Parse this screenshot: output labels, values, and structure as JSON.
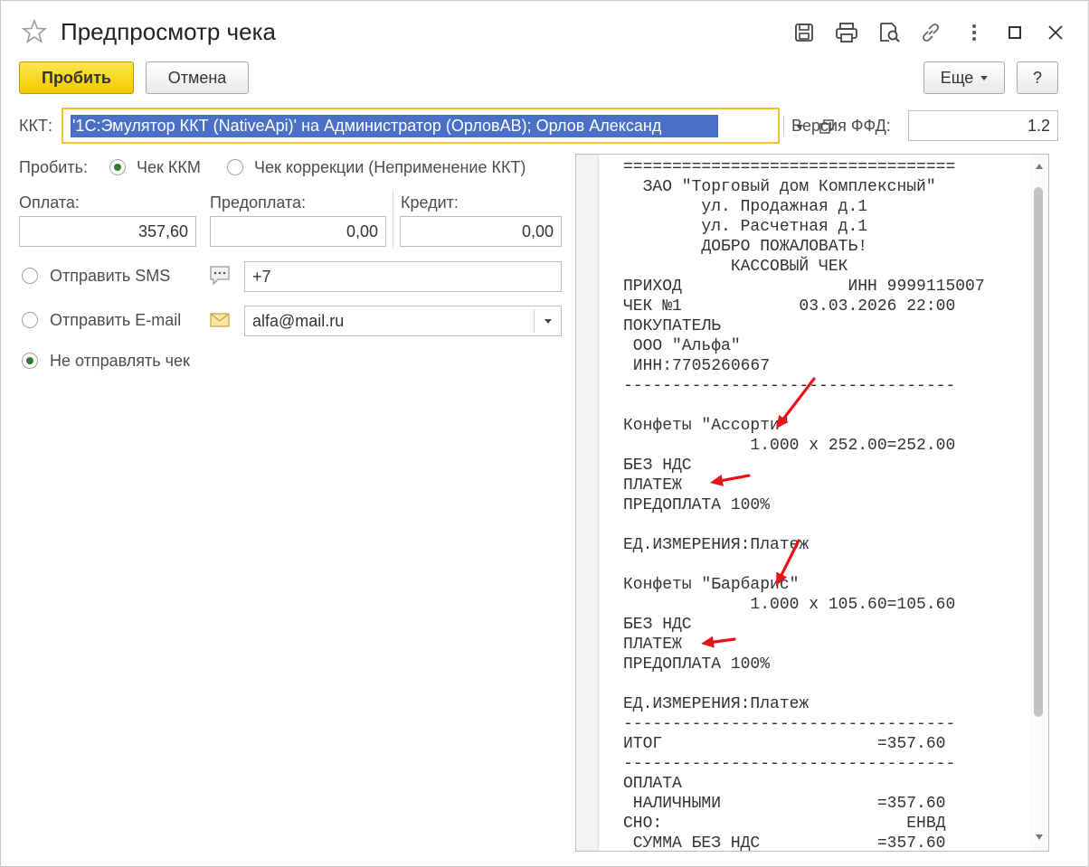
{
  "window": {
    "title": "Предпросмотр чека",
    "icons": [
      "star-icon",
      "save-icon",
      "print-icon",
      "preview-icon",
      "link-icon",
      "more-vertical-icon",
      "maximize-icon",
      "close-icon"
    ]
  },
  "toolbar": {
    "submit_label": "Пробить",
    "cancel_label": "Отмена",
    "more_label": "Еще",
    "help_label": "?"
  },
  "kkt": {
    "label": "ККТ:",
    "value": "'1С:Эмулятор ККТ (NativeApi)' на Администратор (ОрловАВ); Орлов Александ",
    "ffd_label": "Версия ФФД:",
    "ffd_value": "1.2"
  },
  "receipt_type": {
    "label": "Пробить:",
    "options": [
      {
        "label": "Чек ККМ",
        "selected": true
      },
      {
        "label": "Чек коррекции (Неприменение ККТ)",
        "selected": false
      }
    ]
  },
  "payment": {
    "payment_label": "Оплата:",
    "payment_value": "357,60",
    "prepayment_label": "Предоплата:",
    "prepayment_value": "0,00",
    "credit_label": "Кредит:",
    "credit_value": "0,00"
  },
  "send": {
    "sms_label": "Отправить SMS",
    "sms_value": "+7",
    "email_label": "Отправить E-mail",
    "email_value": "alfa@mail.ru",
    "none_label": "Не отправлять чек",
    "selected": "none"
  },
  "receipt": {
    "lines": [
      "==================================",
      "  ЗАО \"Торговый дом Комплексный\"",
      "        ул. Продажная д.1",
      "        ул. Расчетная д.1",
      "        ДОБРО ПОЖАЛОВАТЬ!",
      "           КАССОВЫЙ ЧЕК",
      "ПРИХОД                 ИНН 9999115007",
      "ЧЕК №1            03.03.2026 22:00",
      "ПОКУПАТЕЛЬ",
      " ООО \"Альфа\"",
      " ИНН:7705260667",
      "----------------------------------",
      "",
      "Конфеты \"Ассорти\"",
      "             1.000 x 252.00=252.00",
      "БЕЗ НДС",
      "ПЛАТЕЖ",
      "ПРЕДОПЛАТА 100%",
      "",
      "ЕД.ИЗМЕРЕНИЯ:Платеж",
      "",
      "Конфеты \"Барбарис\"",
      "             1.000 x 105.60=105.60",
      "БЕЗ НДС",
      "ПЛАТЕЖ",
      "ПРЕДОПЛАТА 100%",
      "",
      "ЕД.ИЗМЕРЕНИЯ:Платеж",
      "----------------------------------",
      "ИТОГ                      =357.60",
      "----------------------------------",
      "ОПЛАТА",
      " НАЛИЧНЫМИ                =357.60",
      "СНО:                         ЕНВД",
      " СУММА БЕЗ НДС            =357.60"
    ],
    "annotation_color": "#e8131b"
  }
}
